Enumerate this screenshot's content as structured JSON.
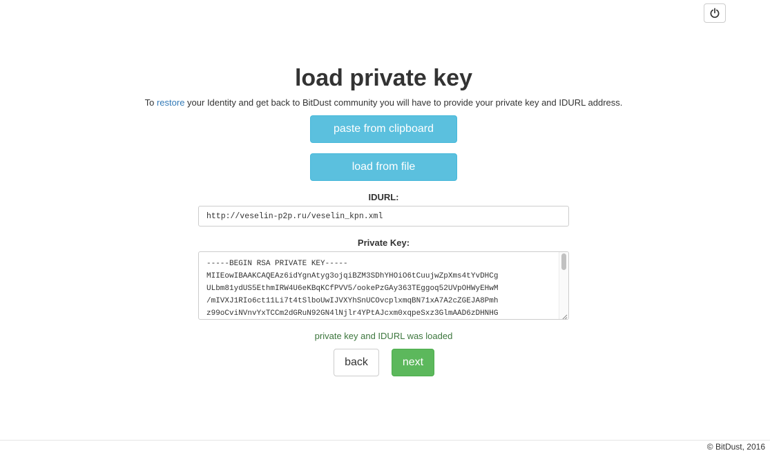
{
  "header": {
    "power_icon": "power-icon"
  },
  "page": {
    "title": "load private key",
    "intro": {
      "before": "To ",
      "link": "restore",
      "after": " your Identity and get back to BitDust community you will have to provide your private key and IDURL address."
    }
  },
  "actions": {
    "paste_label": "paste from clipboard",
    "file_label": "load from file"
  },
  "idurl": {
    "label": "IDURL:",
    "value": "http://veselin-p2p.ru/veselin_kpn.xml"
  },
  "private_key": {
    "label": "Private Key:",
    "value": "-----BEGIN RSA PRIVATE KEY-----\nMIIEowIBAAKCAQEAz6idYgnAtyg3ojqiBZM3SDhYHOiO6tCuujwZpXms4tYvDHCg\nULbm81ydUS5EthmIRW4U6eKBqKCfPVV5/ookePzGAy363TEggoq52UVpOHWyEHwM\n/mIVXJ1RIo6ct11Li7t4tSlboUwIJVXYhSnUCOvcplxmqBN71xA7A2cZGEJA8Pmh\nz99oCviNVnvYxTCCm2dGRuN92GN4lNjlr4YPtAJcxm0xqpeSxz3GlmAAD6zDHNHG"
  },
  "status": {
    "message": "private key and IDURL was loaded",
    "color": "#3c763d"
  },
  "nav": {
    "back_label": "back",
    "next_label": "next"
  },
  "footer": {
    "copyright": "© BitDust, 2016"
  }
}
